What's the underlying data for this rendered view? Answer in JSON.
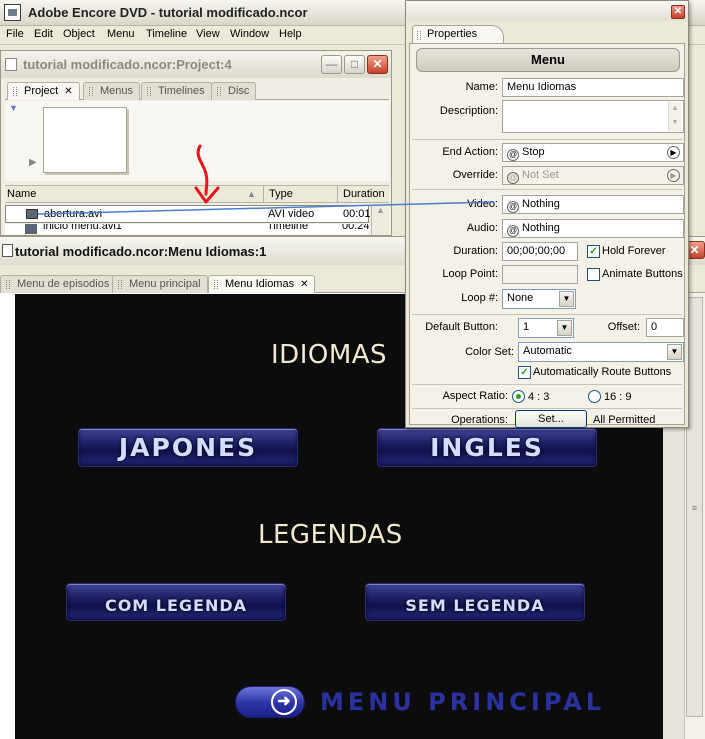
{
  "app": {
    "title": "Adobe Encore DVD - tutorial modificado.ncor",
    "menu": [
      "File",
      "Edit",
      "Object",
      "Menu",
      "Timeline",
      "View",
      "Window",
      "Help"
    ]
  },
  "project_window": {
    "title": "tutorial modificado.ncor:Project:4",
    "tabs": [
      "Project",
      "Menus",
      "Timelines",
      "Disc"
    ],
    "columns": [
      "Name",
      "Type",
      "Duration"
    ],
    "rows": [
      {
        "name": "abertura.avi",
        "type": "AVI video",
        "duration": "00:01"
      },
      {
        "name": "inicio menu.avi1",
        "type": "Timeline",
        "duration": "00:24"
      }
    ]
  },
  "menu_window": {
    "title": "tutorial modificado.ncor:Menu Idiomas:1",
    "tabs": [
      "Menu de episodios",
      "Menu principal",
      "Menu Idiomas"
    ],
    "canvas": {
      "heading_idiomas": "IDIOMAS",
      "button_japones": "JAPONES",
      "button_ingles": "INGLES",
      "heading_legendas": "LEGENDAS",
      "button_com_legenda": "COM LEGENDA",
      "button_sem_legenda": "SEM LEGENDA",
      "menu_principal": "MENU PRINCIPAL"
    }
  },
  "properties": {
    "tab": "Properties",
    "header": "Menu",
    "labels": {
      "name": "Name:",
      "description": "Description:",
      "end_action": "End Action:",
      "override": "Override:",
      "video": "Video:",
      "audio": "Audio:",
      "duration": "Duration:",
      "loop_point": "Loop Point:",
      "loop_count": "Loop #:",
      "default_button": "Default Button:",
      "offset": "Offset:",
      "color_set": "Color Set:",
      "aspect_ratio": "Aspect Ratio:",
      "operations": "Operations:"
    },
    "values": {
      "name": "Menu Idiomas",
      "description": "",
      "end_action": "Stop",
      "override": "Not Set",
      "video": "Nothing",
      "audio": "Nothing",
      "duration": "00;00;00;00",
      "hold_forever": "Hold Forever",
      "animate_buttons": "Animate Buttons",
      "loop_count": "None",
      "default_button": "1",
      "offset": "0",
      "color_set": "Automatic",
      "auto_route": "Automatically Route Buttons",
      "aspect_4_3": "4 : 3",
      "aspect_16_9": "16 : 9",
      "operations_button": "Set...",
      "operations_status": "All Permitted"
    },
    "checked": {
      "hold_forever": true,
      "animate_buttons": false,
      "auto_route": true
    },
    "aspect_selected": "4 : 3"
  },
  "annotation_colors": {
    "arrow": "#e8141c",
    "link_line": "#4a7fc8"
  }
}
